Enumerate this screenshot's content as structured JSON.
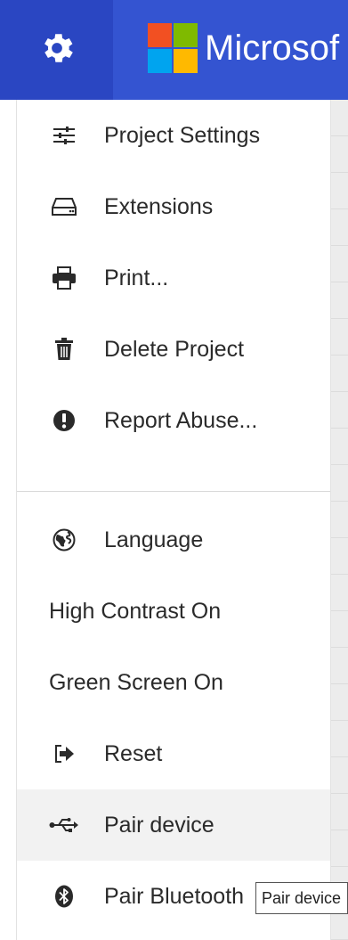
{
  "header": {
    "brand_text": "Microsof",
    "colors": {
      "header_bg": "#3454d1",
      "gear_bg": "#2a46c2",
      "logo": [
        "#f25022",
        "#7fba00",
        "#00a4ef",
        "#ffb900"
      ]
    }
  },
  "menu": {
    "items": [
      {
        "label": "Project Settings",
        "icon": "sliders-icon"
      },
      {
        "label": "Extensions",
        "icon": "drive-icon"
      },
      {
        "label": "Print...",
        "icon": "printer-icon"
      },
      {
        "label": "Delete Project",
        "icon": "trash-icon"
      },
      {
        "label": "Report Abuse...",
        "icon": "exclamation-icon"
      },
      {
        "label": "Language",
        "icon": "globe-icon"
      },
      {
        "label": "High Contrast On",
        "icon": ""
      },
      {
        "label": "Green Screen On",
        "icon": ""
      },
      {
        "label": "Reset",
        "icon": "sign-out-icon"
      },
      {
        "label": "Pair device",
        "icon": "usb-icon"
      },
      {
        "label": "Pair Bluetooth",
        "icon": "bluetooth-icon"
      }
    ]
  },
  "tooltip": {
    "text": "Pair device"
  }
}
